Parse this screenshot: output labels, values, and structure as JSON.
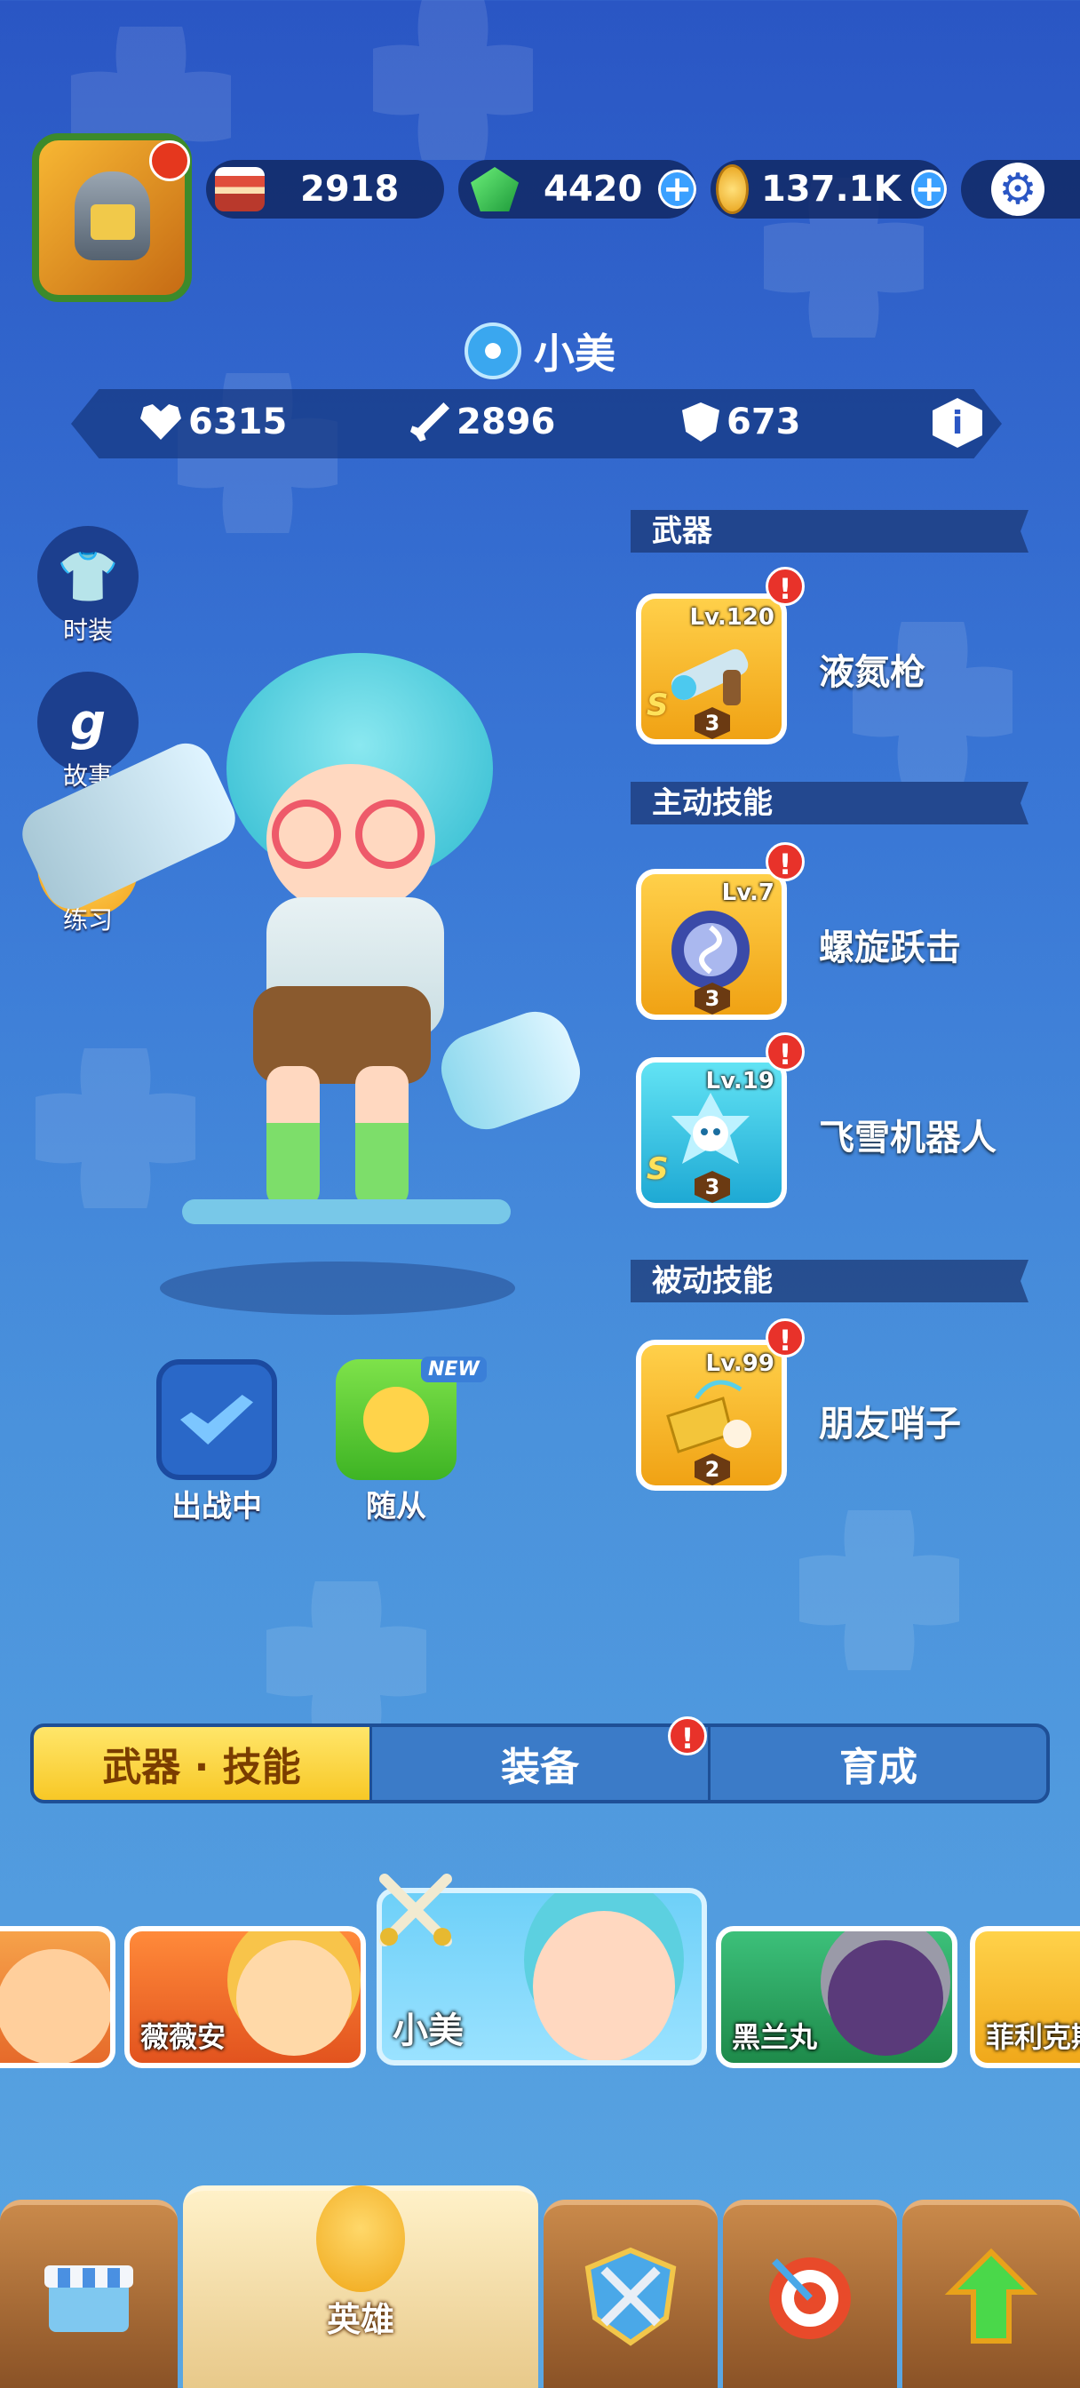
{
  "resources": {
    "cake": "2918",
    "gems": "4420",
    "coins": "137.1K"
  },
  "hero": {
    "name": "小美",
    "stats": {
      "hp": "6315",
      "attack": "2896",
      "defense": "673"
    }
  },
  "side_buttons": [
    {
      "label": "时装",
      "icon": "shirt-icon"
    },
    {
      "label": "故事",
      "icon": "story-book-icon"
    },
    {
      "label": "练习",
      "icon": "gamepad-icon"
    }
  ],
  "actions": {
    "battle_label": "出战中",
    "follow_label": "随从",
    "new_tag": "NEW"
  },
  "sections": {
    "weapon": "武器",
    "active_skill": "主动技能",
    "passive_skill": "被动技能"
  },
  "items": {
    "weapon": {
      "name": "液氮枪",
      "level": "Lv.120",
      "rank": "3",
      "s": "S"
    },
    "skill1": {
      "name": "螺旋跃击",
      "level": "Lv.7",
      "rank": "3"
    },
    "skill2": {
      "name": "飞雪机器人",
      "level": "Lv.19",
      "rank": "3",
      "s": "S"
    },
    "passive": {
      "name": "朋友哨子",
      "level": "Lv.99",
      "rank": "2"
    }
  },
  "alert_mark": "!",
  "tabs": [
    "武器 · 技能",
    "装备",
    "育成"
  ],
  "roster": [
    "薇薇安",
    "小美",
    "黑兰丸",
    "菲利克斯"
  ],
  "nav": {
    "hero_label": "英雄"
  },
  "colors": {
    "accent": "#f8c826",
    "alert": "#e8322a",
    "background": "#3a78d6"
  }
}
